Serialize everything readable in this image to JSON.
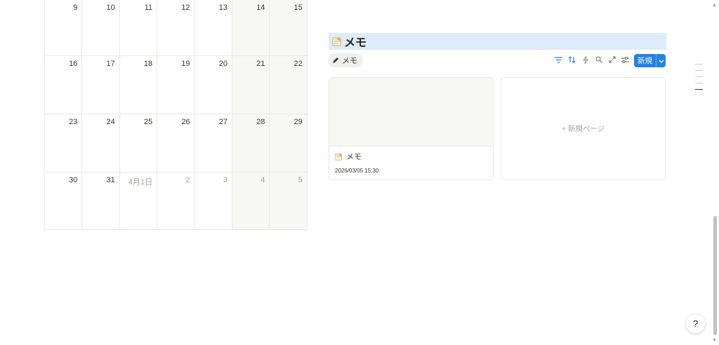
{
  "calendar": {
    "rows": [
      {
        "days": [
          "9",
          "10",
          "11",
          "12",
          "13",
          "14",
          "15"
        ]
      },
      {
        "days": [
          "16",
          "17",
          "18",
          "19",
          "20",
          "21",
          "22"
        ]
      },
      {
        "days": [
          "23",
          "24",
          "25",
          "26",
          "27",
          "28",
          "29"
        ]
      },
      {
        "days": [
          "30",
          "31",
          "4月1日",
          "2",
          "3",
          "4",
          "5"
        ]
      }
    ]
  },
  "memo": {
    "title": "メモ",
    "view_tab": "メモ",
    "new_button": "新規",
    "card": {
      "name": "メモ",
      "date": "2026/03/05 15:30"
    },
    "new_page": "+ 新規ページ"
  },
  "colors": {
    "accent": "#2383e2",
    "title_highlight": "#deecf9",
    "weekend": "#f7f7f5"
  },
  "help_icon": "?"
}
